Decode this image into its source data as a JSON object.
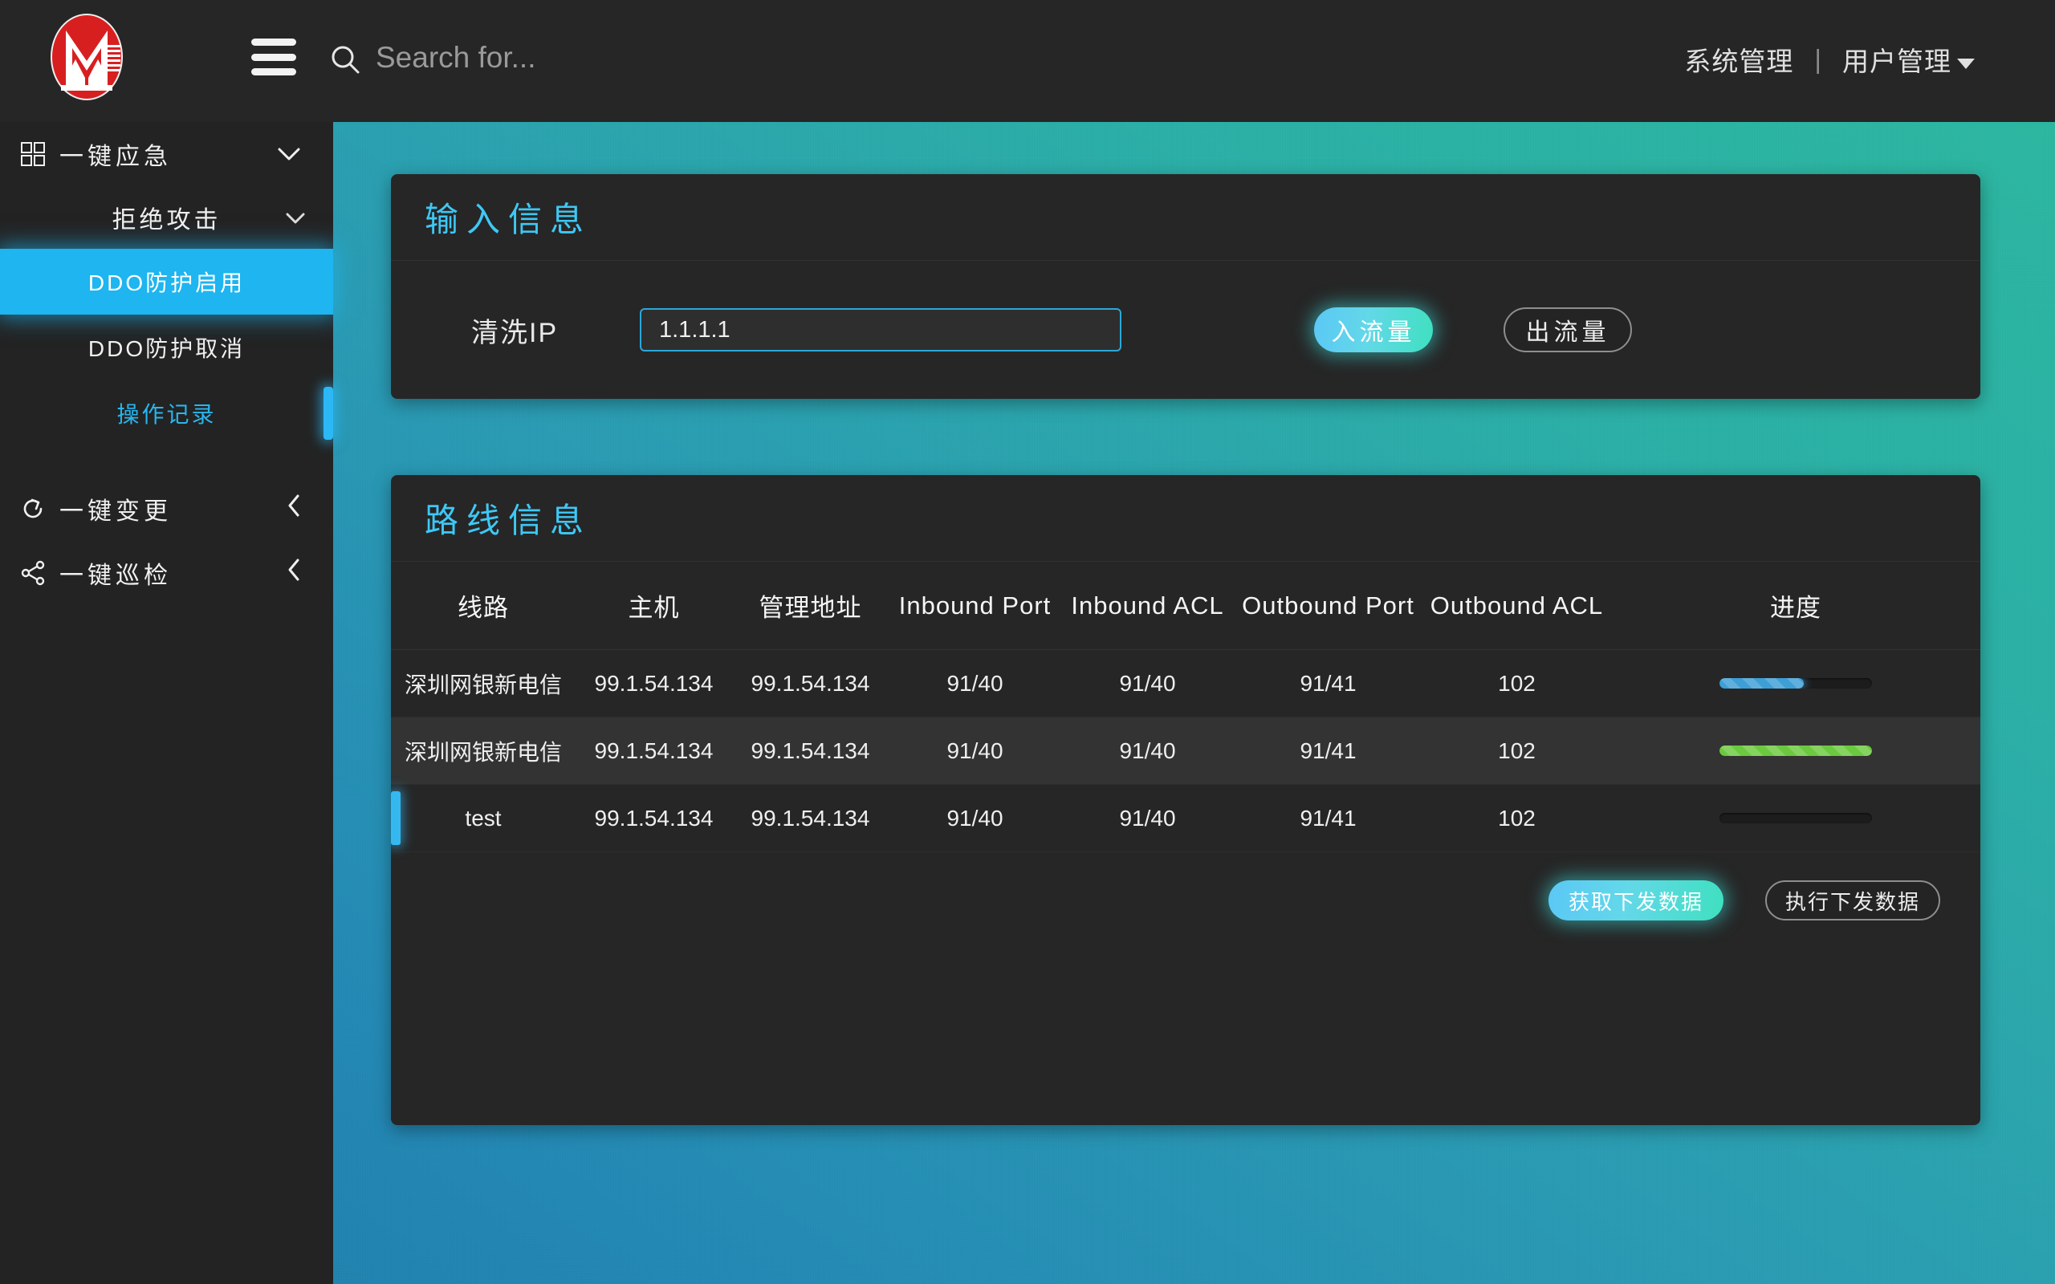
{
  "topbar": {
    "logo_name": "company-logo",
    "menu_icon": "hamburger-icon",
    "search_icon": "search-icon",
    "search_value": "",
    "search_placeholder": "Search for...",
    "nav": {
      "system_management": "系统管理",
      "separator": "|",
      "user_management": "用户管理"
    }
  },
  "sidebar": {
    "groups": [
      {
        "label": "一键应急",
        "icon": "grid-icon",
        "chevron": "chevron-down-icon",
        "expanded": true,
        "submenu": {
          "label": "拒绝攻击",
          "chevron": "chevron-down-icon",
          "items": [
            {
              "label": "DDO防护启用",
              "state": "active"
            },
            {
              "label": "DDO防护取消",
              "state": "normal"
            },
            {
              "label": "操作记录",
              "state": "highlighted"
            }
          ]
        }
      },
      {
        "label": "一键变更",
        "icon": "refresh-icon",
        "chevron": "chevron-left-icon",
        "expanded": false
      },
      {
        "label": "一键巡检",
        "icon": "share-nodes-icon",
        "chevron": "chevron-left-icon",
        "expanded": false
      }
    ]
  },
  "main": {
    "input_panel": {
      "title": "输入信息",
      "field_label": "清洗IP",
      "field_value": "1.1.1.1",
      "field_placeholder": "",
      "buttons": [
        {
          "label": "入流量",
          "style": "primary"
        },
        {
          "label": "出流量",
          "style": "outline"
        }
      ]
    },
    "route_panel": {
      "title": "路线信息",
      "columns": [
        "线路",
        "主机",
        "管理地址",
        "Inbound Port",
        "Inbound ACL",
        "Outbound Port",
        "Outbound ACL",
        "进度"
      ],
      "rows": [
        {
          "line": "深圳网银新电信",
          "host": "99.1.54.134",
          "mgmt_address": "99.1.54.134",
          "inbound_port": "91/40",
          "inbound_acl": "91/40",
          "outbound_port": "91/41",
          "outbound_acl": "102",
          "progress_percent": 55,
          "progress_color": "#3d9fd6",
          "selected": false
        },
        {
          "line": "深圳网银新电信",
          "host": "99.1.54.134",
          "mgmt_address": "99.1.54.134",
          "inbound_port": "91/40",
          "inbound_acl": "91/40",
          "outbound_port": "91/41",
          "outbound_acl": "102",
          "progress_percent": 100,
          "progress_color": "#6cc93f",
          "selected": false
        },
        {
          "line": "test",
          "host": "99.1.54.134",
          "mgmt_address": "99.1.54.134",
          "inbound_port": "91/40",
          "inbound_acl": "91/40",
          "outbound_port": "91/41",
          "outbound_acl": "102",
          "progress_percent": 0,
          "progress_color": "#3d9fd6",
          "selected": true
        }
      ],
      "buttons": [
        {
          "label": "获取下发数据",
          "style": "primary"
        },
        {
          "label": "执行下发数据",
          "style": "outline"
        }
      ]
    }
  },
  "colors": {
    "accent_cyan": "#3ec8f5",
    "active_blue": "#1eb5f0",
    "panel_bg": "#262626",
    "sidebar_bg": "#232323",
    "bg_gradient_start": "#2389b5",
    "bg_gradient_end": "#2cb9a0",
    "logo_red": "#d81f20"
  }
}
